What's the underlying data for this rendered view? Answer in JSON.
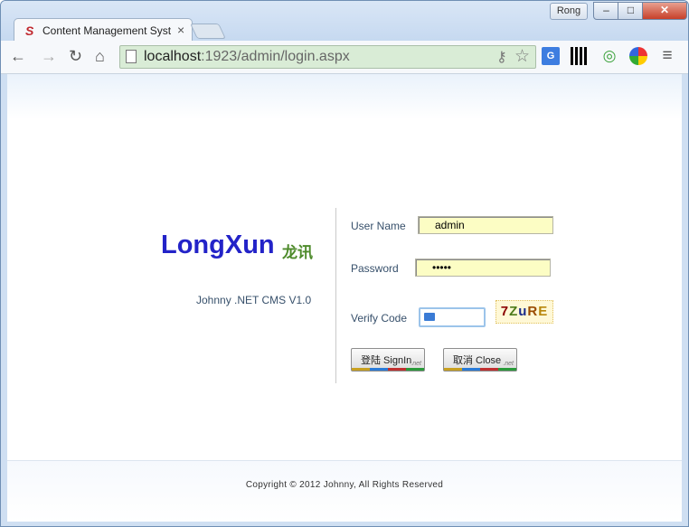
{
  "window": {
    "user": "Rong",
    "min_glyph": "–",
    "max_glyph": "□",
    "close_glyph": "✕"
  },
  "tab": {
    "title": "Content Management System",
    "close_glyph": "×"
  },
  "toolbar": {
    "url_host": "localhost",
    "url_rest": ":1923/admin/login.aspx",
    "back_glyph": "←",
    "forward_glyph": "→",
    "reload_glyph": "↻",
    "home_glyph": "⌂",
    "menu_glyph": "≡"
  },
  "brand": {
    "name": "LongXun",
    "name_cn": "龙讯",
    "version": "Johnny .NET CMS V1.0"
  },
  "form": {
    "username_label": "User Name",
    "username_value": "admin",
    "password_label": "Password",
    "password_value": "•••••",
    "verify_label": "Verify Code",
    "captcha": [
      "7",
      "Z",
      "u",
      "R",
      "E"
    ]
  },
  "buttons": {
    "signin_label": "登陆 SignIn",
    "close_label": "取消 Close",
    "badge": ".net"
  },
  "footer": {
    "copyright": "Copyright © 2012 Johnny, All Rights Reserved"
  },
  "colors": {
    "brand_blue": "#2323c8",
    "brand_green": "#4d8a2a",
    "field_yellow": "#fcfdc4",
    "omnibox_green": "#d9ecd6"
  }
}
